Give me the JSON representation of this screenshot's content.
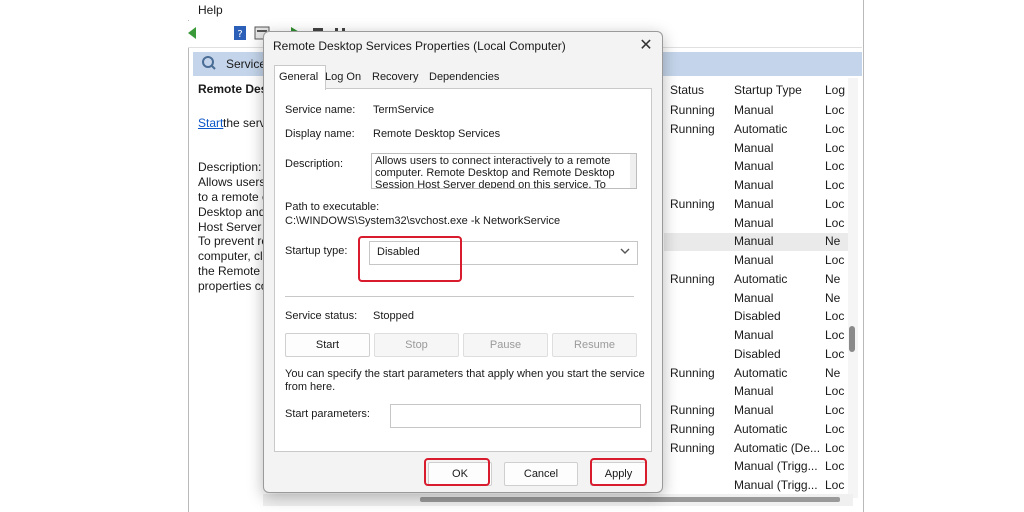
{
  "bg": {
    "menu_help": "Help",
    "header_title": "Service",
    "left": {
      "service_name": "Remote Des",
      "start_link": "Start",
      "start_rest": " the serv",
      "desc_label": "Description:",
      "desc_lines": [
        "Allows users",
        "to a remote c",
        "Desktop and",
        "Host Server c",
        "To prevent re",
        "computer, cl",
        "the Remote t",
        "properties co"
      ]
    },
    "columns": {
      "status": "Status",
      "startup_type": "Startup Type",
      "log_on": "Log"
    },
    "rows": [
      {
        "status": "Running",
        "startup": "Manual",
        "logon": "Loc"
      },
      {
        "status": "Running",
        "startup": "Automatic",
        "logon": "Loc"
      },
      {
        "status": "",
        "startup": "Manual",
        "logon": "Loc"
      },
      {
        "status": "",
        "startup": "Manual",
        "logon": "Loc"
      },
      {
        "status": "",
        "startup": "Manual",
        "logon": "Loc"
      },
      {
        "status": "Running",
        "startup": "Manual",
        "logon": "Loc"
      },
      {
        "status": "",
        "startup": "Manual",
        "logon": "Loc"
      },
      {
        "status": "",
        "startup": "Manual",
        "logon": "Ne"
      },
      {
        "status": "",
        "startup": "Manual",
        "logon": "Loc"
      },
      {
        "status": "Running",
        "startup": "Automatic",
        "logon": "Ne"
      },
      {
        "status": "",
        "startup": "Manual",
        "logon": "Ne"
      },
      {
        "status": "",
        "startup": "Disabled",
        "logon": "Loc"
      },
      {
        "status": "",
        "startup": "Manual",
        "logon": "Loc"
      },
      {
        "status": "",
        "startup": "Disabled",
        "logon": "Loc"
      },
      {
        "status": "Running",
        "startup": "Automatic",
        "logon": "Ne"
      },
      {
        "status": "",
        "startup": "Manual",
        "logon": "Loc"
      },
      {
        "status": "Running",
        "startup": "Manual",
        "logon": "Loc"
      },
      {
        "status": "Running",
        "startup": "Automatic",
        "logon": "Loc"
      },
      {
        "status": "Running",
        "startup": "Automatic (De...",
        "logon": "Loc"
      },
      {
        "status": "",
        "startup": "Manual (Trigg...",
        "logon": "Loc"
      },
      {
        "status": "",
        "startup": "Manual (Trigg...",
        "logon": "Loc"
      }
    ]
  },
  "dialog": {
    "title": "Remote Desktop Services Properties (Local Computer)",
    "close_glyph": "✕",
    "tabs": [
      "General",
      "Log On",
      "Recovery",
      "Dependencies"
    ],
    "service_name_label": "Service name:",
    "service_name_value": "TermService",
    "display_name_label": "Display name:",
    "display_name_value": "Remote Desktop Services",
    "description_label": "Description:",
    "description_value": "Allows users to connect interactively to a remote computer. Remote Desktop and Remote Desktop Session Host Server depend on this service. To",
    "path_label": "Path to executable:",
    "path_value": "C:\\WINDOWS\\System32\\svchost.exe -k NetworkService",
    "startup_type_label": "Startup type:",
    "startup_type_value": "Disabled",
    "service_status_label": "Service status:",
    "service_status_value": "Stopped",
    "buttons": {
      "start": "Start",
      "stop": "Stop",
      "pause": "Pause",
      "resume": "Resume"
    },
    "help_text_line1": "You can specify the start parameters that apply when you start the service",
    "help_text_line2": "from here.",
    "start_params_label": "Start parameters:",
    "start_params_value": "",
    "footer": {
      "ok": "OK",
      "cancel": "Cancel",
      "apply": "Apply"
    }
  },
  "colors": {
    "highlight": "#d81b2d",
    "header_bar": "#c4d4ea",
    "link": "#0a55c9"
  },
  "icons": [
    "services-icon",
    "chevron-down-icon",
    "close-icon",
    "help-book-icon",
    "properties-icon",
    "play-icon",
    "stop-icon",
    "pause-icon"
  ]
}
